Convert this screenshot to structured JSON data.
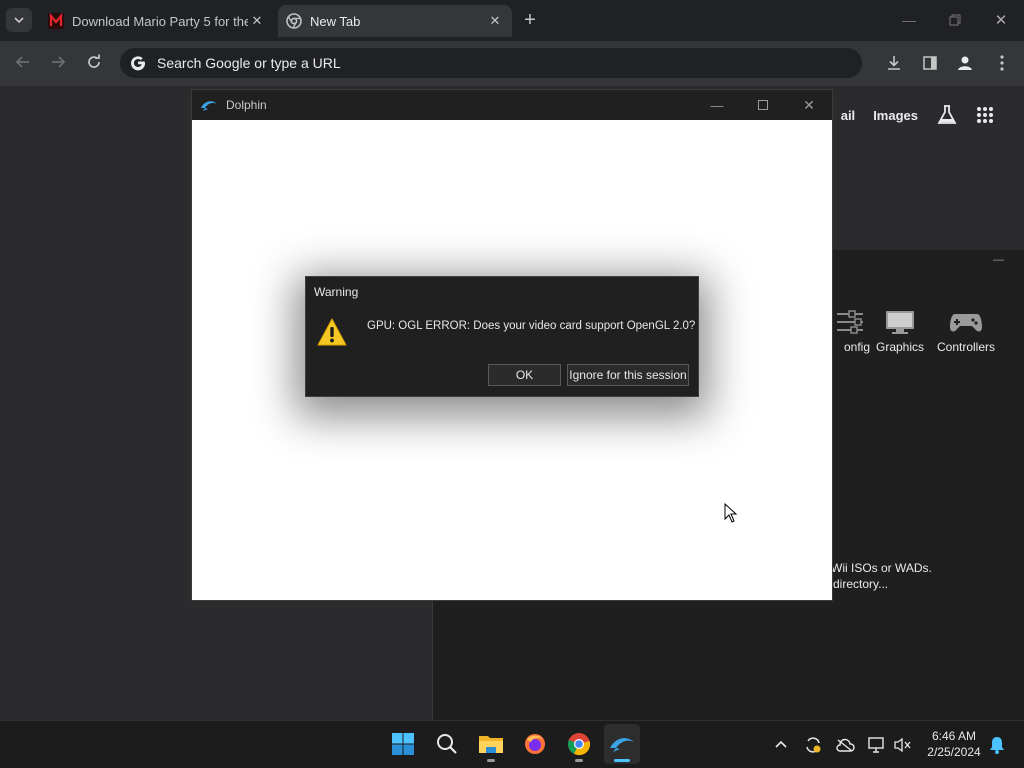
{
  "browser": {
    "tabs": [
      {
        "title": "Download Mario Party 5 for the",
        "active": false
      },
      {
        "title": "New Tab",
        "active": true
      }
    ],
    "omnibox_placeholder": "Search Google or type a URL",
    "ntp_links": {
      "gmail_fragment": "ail",
      "images": "Images"
    }
  },
  "dolphin_main": {
    "toolbar": [
      {
        "label": "onfig",
        "icon": "config-icon"
      },
      {
        "label": "Graphics",
        "icon": "graphics-icon"
      },
      {
        "label": "Controllers",
        "icon": "controllers-icon"
      }
    ],
    "hint_lines": [
      "Wii ISOs or WADs.",
      "directory..."
    ]
  },
  "render_window": {
    "title": "Dolphin"
  },
  "dialog": {
    "title": "Warning",
    "message": "GPU: OGL ERROR: Does your video card support OpenGL 2.0?",
    "ok_label": "OK",
    "ignore_label": "Ignore for this session"
  },
  "taskbar": {
    "time": "6:46 AM",
    "date": "2/25/2024"
  },
  "colors": {
    "accent": "#4cc2ff",
    "warning": "#f6c624"
  }
}
